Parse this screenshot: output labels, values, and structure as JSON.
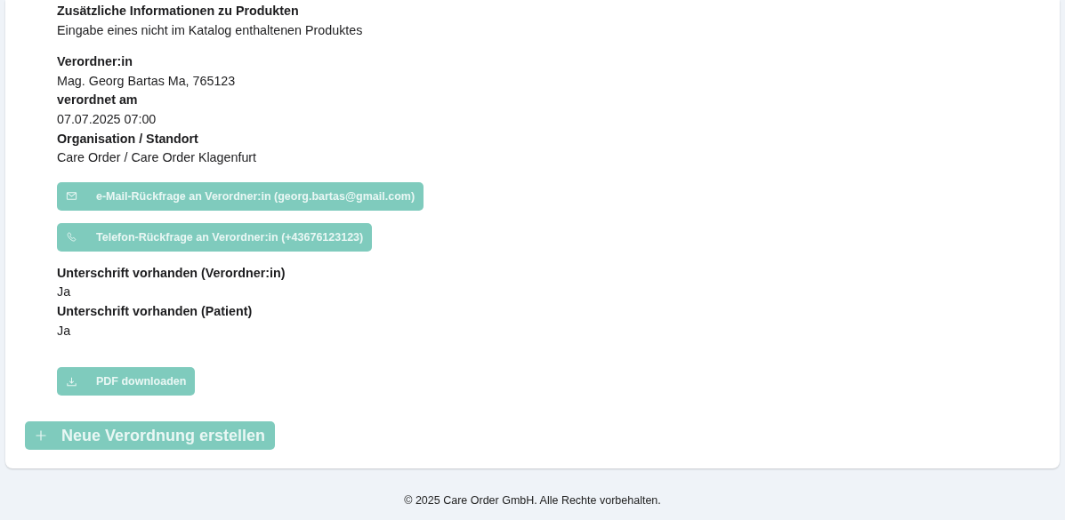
{
  "details": [
    {
      "label": "Zusätzliche Informationen zu Produkten",
      "value": "Eingabe eines nicht im Katalog enthaltenen Produktes"
    }
  ],
  "prescriber": [
    {
      "label": "Verordner:in",
      "value": "Mag. Georg Bartas Ma, 765123"
    },
    {
      "label": "verordnet am",
      "value": "07.07.2025 07:00"
    },
    {
      "label": "Organisation / Standort",
      "value": "Care Order / Care Order Klagenfurt"
    }
  ],
  "contact_buttons": [
    {
      "kind": "mail",
      "label": "e-Mail-Rückfrage an Verordner:in (georg.bartas@gmail.com)"
    },
    {
      "kind": "phone",
      "label": "Telefon-Rückfrage an Verordner:in (+43676123123)"
    }
  ],
  "signatures": [
    {
      "label": "Unterschrift vorhanden (Verordner:in)",
      "value": "Ja"
    },
    {
      "label": "Unterschrift vorhanden (Patient)",
      "value": "Ja"
    }
  ],
  "pdf_button": {
    "kind": "download",
    "label": "PDF downloaden"
  },
  "new_button": {
    "kind": "plus",
    "label": "Neue Verordnung erstellen"
  },
  "footer": "© 2025 Care Order GmbH. Alle Rechte vorbehalten."
}
